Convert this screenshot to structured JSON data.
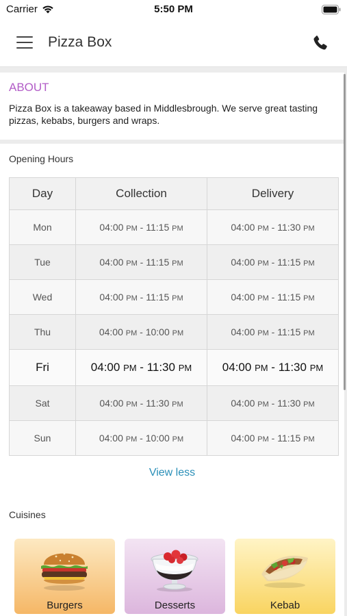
{
  "status_bar": {
    "carrier": "Carrier",
    "time": "5:50 PM"
  },
  "header": {
    "title": "Pizza Box",
    "menu_icon": "hamburger-icon",
    "phone_icon": "phone-icon"
  },
  "about": {
    "title": "ABOUT",
    "text": "Pizza Box is a takeaway based in Middlesbrough. We serve great tasting pizzas, kebabs, burgers and wraps."
  },
  "opening_hours": {
    "title": "Opening Hours",
    "columns": [
      "Day",
      "Collection",
      "Delivery"
    ],
    "rows": [
      {
        "day": "Mon",
        "collection": [
          "04:00",
          "PM",
          "11:15",
          "PM"
        ],
        "delivery": [
          "04:00",
          "PM",
          "11:30",
          "PM"
        ]
      },
      {
        "day": "Tue",
        "collection": [
          "04:00",
          "PM",
          "11:15",
          "PM"
        ],
        "delivery": [
          "04:00",
          "PM",
          "11:15",
          "PM"
        ]
      },
      {
        "day": "Wed",
        "collection": [
          "04:00",
          "PM",
          "11:15",
          "PM"
        ],
        "delivery": [
          "04:00",
          "PM",
          "11:15",
          "PM"
        ]
      },
      {
        "day": "Thu",
        "collection": [
          "04:00",
          "PM",
          "10:00",
          "PM"
        ],
        "delivery": [
          "04:00",
          "PM",
          "11:15",
          "PM"
        ]
      },
      {
        "day": "Fri",
        "collection": [
          "04:00",
          "PM",
          "11:30",
          "PM"
        ],
        "delivery": [
          "04:00",
          "PM",
          "11:30",
          "PM"
        ]
      },
      {
        "day": "Sat",
        "collection": [
          "04:00",
          "PM",
          "11:30",
          "PM"
        ],
        "delivery": [
          "04:00",
          "PM",
          "11:30",
          "PM"
        ]
      },
      {
        "day": "Sun",
        "collection": [
          "04:00",
          "PM",
          "10:00",
          "PM"
        ],
        "delivery": [
          "04:00",
          "PM",
          "11:15",
          "PM"
        ]
      }
    ],
    "highlighted_day": "Fri",
    "toggle_label": "View less"
  },
  "cuisines": {
    "title": "Cuisines",
    "items": [
      {
        "label": "Burgers",
        "icon": "burger-icon"
      },
      {
        "label": "Desserts",
        "icon": "dessert-icon"
      },
      {
        "label": "Kebab",
        "icon": "kebab-icon"
      }
    ]
  },
  "colors": {
    "accent": "#b25cc7",
    "link": "#2a8fb8"
  }
}
